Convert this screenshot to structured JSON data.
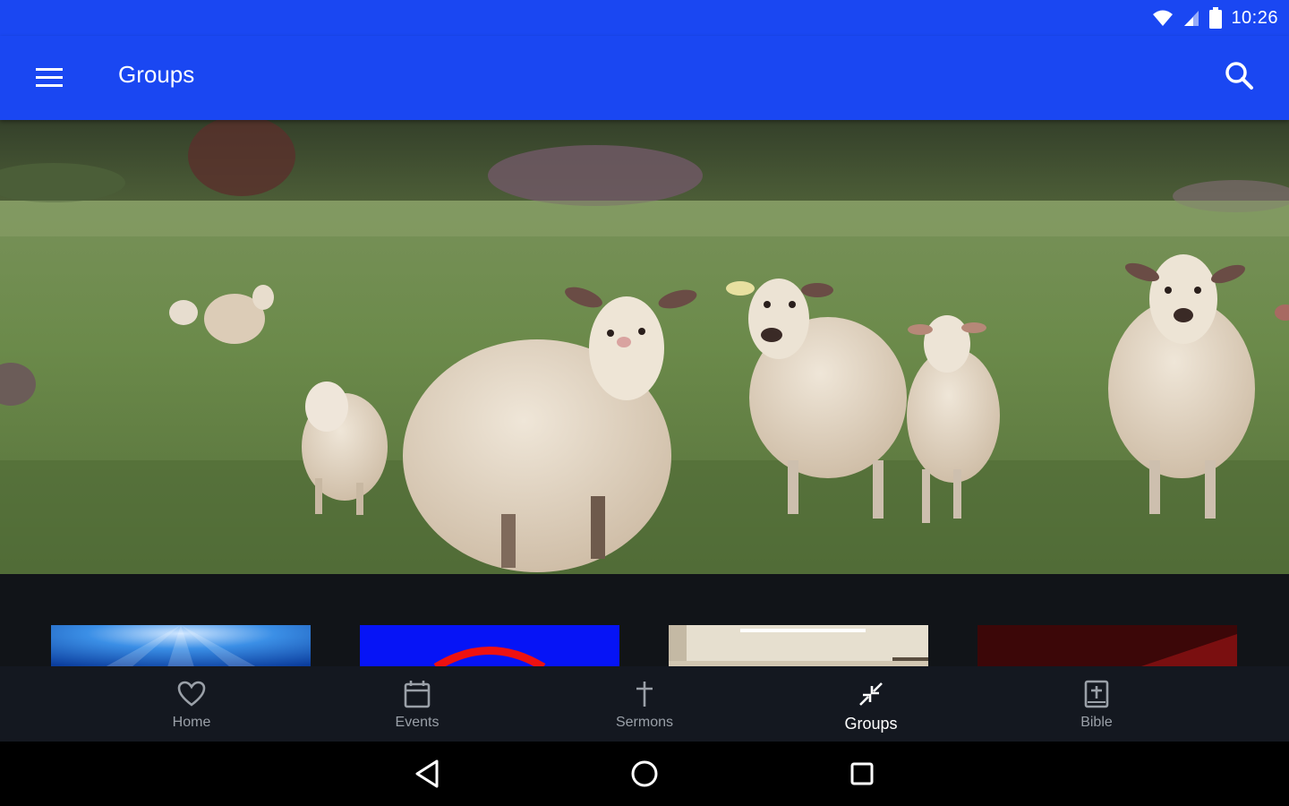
{
  "status_bar": {
    "time": "10:26",
    "icons": [
      "wifi-icon",
      "signal-icon",
      "battery-icon"
    ]
  },
  "app_bar": {
    "title": "Groups",
    "menu_icon": "menu-icon",
    "search_icon": "search-icon",
    "color": "#1a47f2"
  },
  "hero": {
    "image": "sheep-in-field-photo"
  },
  "cards": [
    {
      "name": "blue-rays-card"
    },
    {
      "name": "blue-red-arc-card"
    },
    {
      "name": "room-interior-card"
    },
    {
      "name": "dark-red-card"
    }
  ],
  "bottom_nav": {
    "items": [
      {
        "label": "Home",
        "icon": "heart-icon",
        "active": false
      },
      {
        "label": "Events",
        "icon": "calendar-icon",
        "active": false
      },
      {
        "label": "Sermons",
        "icon": "cross-icon",
        "active": false
      },
      {
        "label": "Groups",
        "icon": "arrows-inward-icon",
        "active": true
      },
      {
        "label": "Bible",
        "icon": "bible-icon",
        "active": false
      }
    ]
  },
  "system_nav": {
    "buttons": [
      "back-icon",
      "home-circle-icon",
      "recents-icon"
    ]
  }
}
